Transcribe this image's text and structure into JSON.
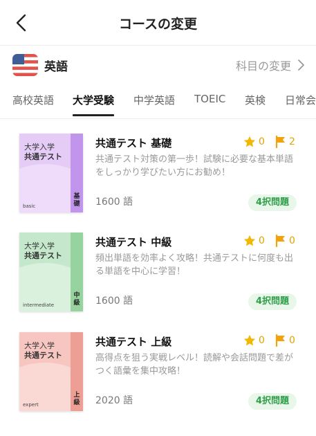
{
  "header": {
    "title": "コースの変更"
  },
  "subject": {
    "name": "英語",
    "change_label": "科目の変更"
  },
  "tabs": [
    {
      "label": "高校英語",
      "active": false
    },
    {
      "label": "大学受験",
      "active": true
    },
    {
      "label": "中学英語",
      "active": false
    },
    {
      "label": "TOEIC",
      "active": false
    },
    {
      "label": "英検",
      "active": false
    },
    {
      "label": "日常会",
      "active": false
    }
  ],
  "courses": [
    {
      "cover": {
        "line1": "大学入学",
        "line2": "共通テスト",
        "level": "基礎",
        "tag": "basic",
        "colors": {
          "bg": "#e4ccf6",
          "curve": "#eedcfa",
          "strip": "#c195ec"
        }
      },
      "title": "共通テスト 基礎",
      "stars": "0",
      "flags": "2",
      "description": "共通テスト対策の第一歩！試験に必要な基本単語をしっかり学びたい方にお勧め！",
      "word_count": "1600 語",
      "quiz": "4択問題"
    },
    {
      "cover": {
        "line1": "大学入学",
        "line2": "共通テスト",
        "level": "中級",
        "tag": "intermediate",
        "colors": {
          "bg": "#c5e8cc",
          "curve": "#d9f1dd",
          "strip": "#97d39f"
        }
      },
      "title": "共通テスト 中級",
      "stars": "0",
      "flags": "0",
      "description": "頻出単語を効率よく攻略！共通テストに何度も出る単語を中心に学習！",
      "word_count": "1600 語",
      "quiz": "4択問題"
    },
    {
      "cover": {
        "line1": "大学入学",
        "line2": "共通テスト",
        "level": "上級",
        "tag": "expert",
        "colors": {
          "bg": "#f7c6c0",
          "curve": "#fad9d4",
          "strip": "#ee9f95"
        }
      },
      "title": "共通テスト 上級",
      "stars": "0",
      "flags": "0",
      "description": "高得点を狙う実戦レベル！読解や会話問題で差がつく語彙を集中攻略！",
      "word_count": "2020 語",
      "quiz": "4択問題"
    }
  ],
  "icons": {
    "back": "chevron-left-icon",
    "flag": "us-flag-icon",
    "chevron": "chevron-right-icon",
    "star": "star-icon",
    "bookmark": "flag-icon"
  },
  "colors": {
    "star": "#f2b705",
    "flag": "#f2a20c",
    "quiz_bg": "#e8f7ea",
    "quiz_text": "#2e9e47"
  }
}
